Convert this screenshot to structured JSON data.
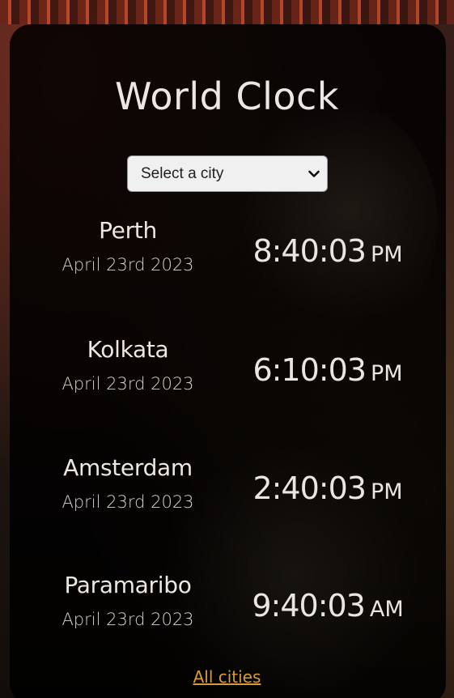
{
  "title": "World Clock",
  "city_select": {
    "selected_label": "Select a city"
  },
  "cities": [
    {
      "name": "Perth",
      "date": "April 23rd 2023",
      "time": "8:40:03",
      "ampm": "PM"
    },
    {
      "name": "Kolkata",
      "date": "April 23rd 2023",
      "time": "6:10:03",
      "ampm": "PM"
    },
    {
      "name": "Amsterdam",
      "date": "April 23rd 2023",
      "time": "2:40:03",
      "ampm": "PM"
    },
    {
      "name": "Paramaribo",
      "date": "April 23rd 2023",
      "time": "9:40:03",
      "ampm": "AM"
    }
  ],
  "footer_link": "All cities",
  "colors": {
    "link": "#d79c3a",
    "card": "#000000",
    "text": "#ece6e4"
  }
}
